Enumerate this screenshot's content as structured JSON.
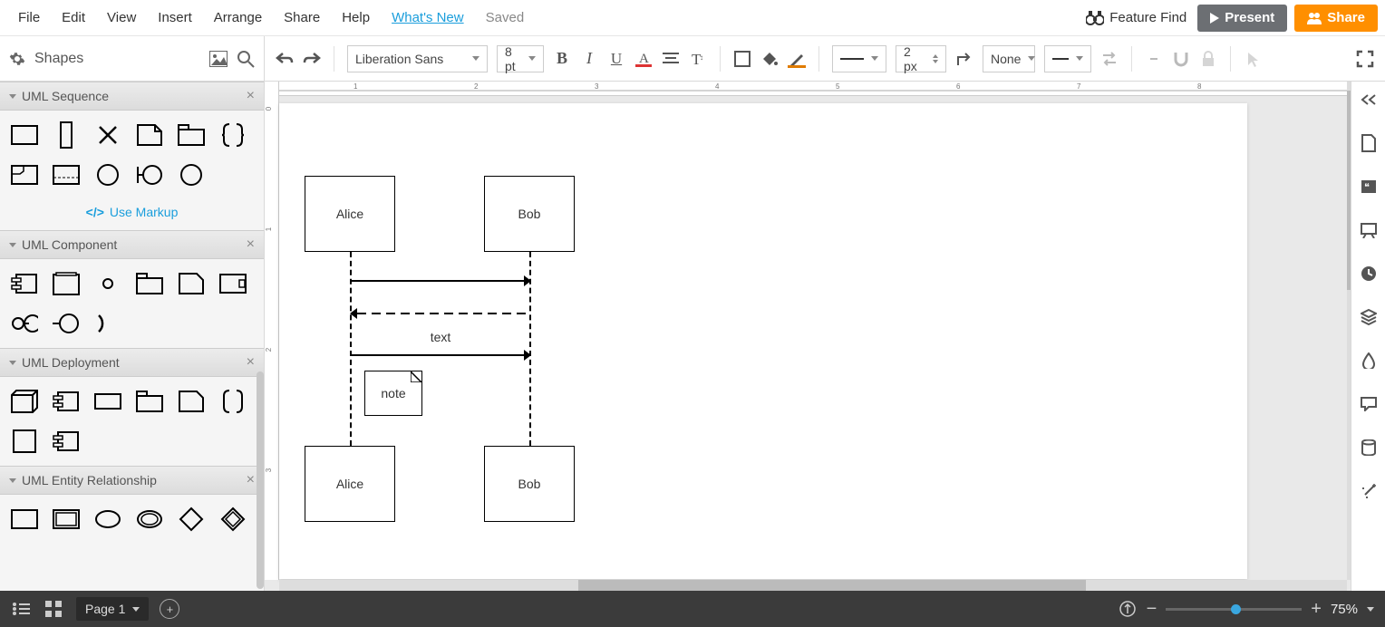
{
  "menu": {
    "file": "File",
    "edit": "Edit",
    "view": "View",
    "insert": "Insert",
    "arrange": "Arrange",
    "share": "Share",
    "help": "Help",
    "whatsnew": "What's New",
    "saved": "Saved",
    "feature_find": "Feature Find",
    "present": "Present",
    "share_btn": "Share"
  },
  "toolbar": {
    "shapes": "Shapes",
    "font": "Liberation Sans",
    "size": "8 pt",
    "line_width": "2 px",
    "endpoints": "None"
  },
  "sidebar": {
    "groups": [
      {
        "title": "UML Sequence",
        "markup": "Use Markup"
      },
      {
        "title": "UML Component"
      },
      {
        "title": "UML Deployment"
      },
      {
        "title": "UML Entity Relationship"
      }
    ]
  },
  "diagram": {
    "alice": "Alice",
    "bob": "Bob",
    "text": "text",
    "note": "note"
  },
  "status": {
    "page": "Page 1",
    "zoom": "75%"
  }
}
